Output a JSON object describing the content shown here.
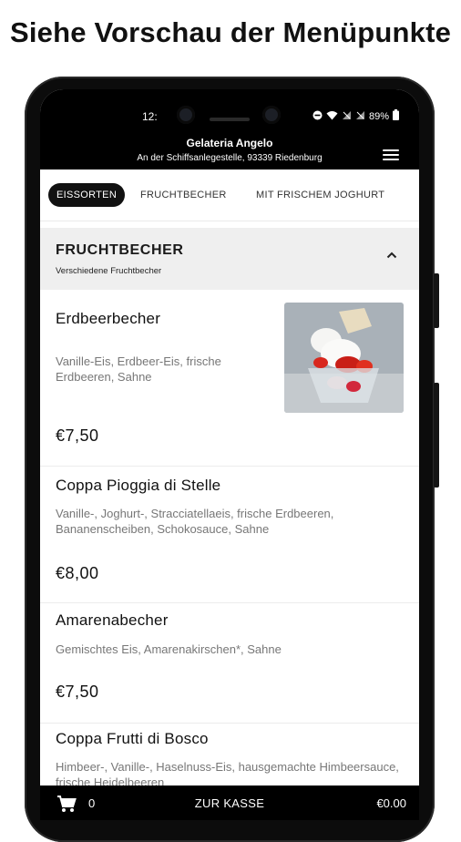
{
  "headline": "Siehe Vorschau der Menüpunkte",
  "status": {
    "time": "12:",
    "battery": "89%"
  },
  "shop": {
    "name": "Gelateria Angelo",
    "address": "An der Schiffsanlegestelle, 93339 Riedenburg"
  },
  "tabs": [
    {
      "label": "EISSORTEN"
    },
    {
      "label": "FRUCHTBECHER"
    },
    {
      "label": "MIT FRISCHEM JOGHURT"
    }
  ],
  "section": {
    "title": "FRUCHTBECHER",
    "subtitle": "Verschiedene Fruchtbecher"
  },
  "items": [
    {
      "name": "Erdbeerbecher",
      "desc": "Vanille-Eis, Erdbeer-Eis, frische Erdbeeren, Sahne",
      "price": "€7,50"
    },
    {
      "name": "Coppa Pioggia di Stelle",
      "desc": "Vanille-, Joghurt-, Stracciatellaeis, frische Erdbeeren, Bananenscheiben, Schokosauce, Sahne",
      "price": "€8,00"
    },
    {
      "name": "Amarenabecher",
      "desc": "Gemischtes Eis, Amarenakirschen*, Sahne",
      "price": "€7,50"
    },
    {
      "name": "Coppa Frutti di Bosco",
      "desc": "Himbeer-, Vanille-, Haselnuss-Eis, hausgemachte Himbeersauce, frische Heidelbeeren",
      "price": ""
    }
  ],
  "cart": {
    "count": "0",
    "checkout_label": "ZUR KASSE",
    "total": "€0.00"
  },
  "colors": {
    "bar": "#000000",
    "section_bg": "#efefef",
    "active_tab": "#111111"
  },
  "icons": [
    "menu-icon",
    "chevron-up-icon",
    "cart-icon",
    "wifi-icon",
    "battery-icon"
  ]
}
